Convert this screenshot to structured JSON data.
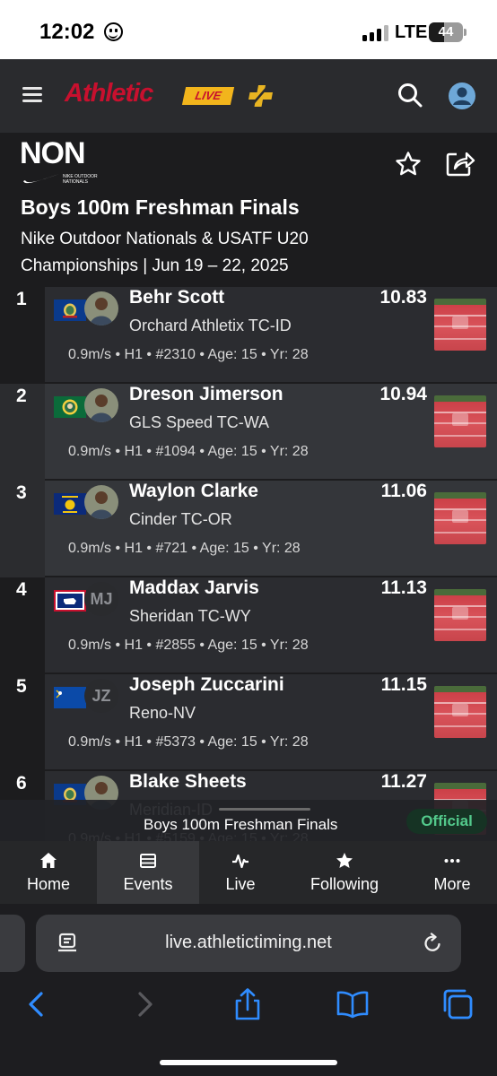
{
  "status_bar": {
    "time": "12:02",
    "network": "LTE",
    "battery": "44"
  },
  "navbar": {
    "logo_text": "Athletic",
    "logo_badge": "LIVE"
  },
  "event": {
    "brand_mark": "NON",
    "brand_sub": "NIKE OUTDOOR NATIONALS",
    "title": "Boys 100m Freshman Finals",
    "meet": "Nike Outdoor Nationals & USATF U20 Championships | Jun 19 – 22, 2025"
  },
  "results": [
    {
      "place": "1",
      "name": "Behr Scott",
      "team": "Orchard Athletix TC-ID",
      "mark": "10.83",
      "details": "0.9m/s • H1 • #2310 • Age: 15 • Yr: 28",
      "flag": "idaho",
      "avatar": ""
    },
    {
      "place": "2",
      "name": "Dreson Jimerson",
      "team": "GLS Speed TC-WA",
      "mark": "10.94",
      "details": "0.9m/s • H1 • #1094 • Age: 15 • Yr: 28",
      "flag": "washington",
      "avatar": ""
    },
    {
      "place": "3",
      "name": "Waylon Clarke",
      "team": "Cinder TC-OR",
      "mark": "11.06",
      "details": "0.9m/s • H1 • #721 • Age: 15 • Yr: 28",
      "flag": "oregon",
      "avatar": ""
    },
    {
      "place": "4",
      "name": "Maddax Jarvis",
      "team": "Sheridan TC-WY",
      "mark": "11.13",
      "details": "0.9m/s • H1 • #2855 • Age: 15 • Yr: 28",
      "flag": "wyoming",
      "avatar": "MJ"
    },
    {
      "place": "5",
      "name": "Joseph Zuccarini",
      "team": "Reno-NV",
      "mark": "11.15",
      "details": "0.9m/s • H1 • #5373 • Age: 15 • Yr: 28",
      "flag": "nevada",
      "avatar": "JZ"
    },
    {
      "place": "6",
      "name": "Blake Sheets",
      "team": "Meridian-ID",
      "mark": "11.27",
      "details": "0.9m/s • H1 • #5159 • Age: 15 • Yr: 28",
      "flag": "idaho",
      "avatar": ""
    }
  ],
  "now_viewing": {
    "title": "Boys 100m Freshman Finals",
    "status": "Official"
  },
  "tabs": [
    {
      "label": "Home",
      "icon": "home-icon"
    },
    {
      "label": "Events",
      "icon": "list-icon"
    },
    {
      "label": "Live",
      "icon": "pulse-icon"
    },
    {
      "label": "Following",
      "icon": "star-icon"
    },
    {
      "label": "More",
      "icon": "ellipsis-icon"
    }
  ],
  "browser": {
    "url": "live.athletictiming.net"
  },
  "colors": {
    "background": "#1c1c1e",
    "card": "#2b2c30",
    "brand_red": "#c8102e",
    "brand_gold": "#f2b51c",
    "official_green": "#53c98b"
  }
}
